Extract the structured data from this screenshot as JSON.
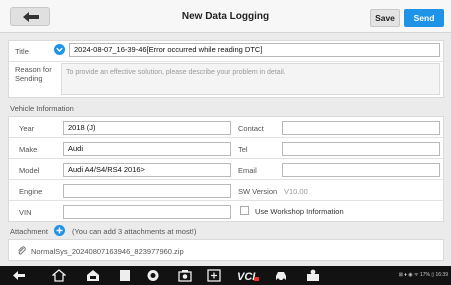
{
  "header": {
    "title": "New Data Logging",
    "save_label": "Save",
    "send_label": "Send"
  },
  "form": {
    "title_label": "Title",
    "title_value": "2024-08-07_16-39-46[Error occurred while reading DTC]",
    "reason_label": "Reason for Sending",
    "reason_placeholder": "To provide an effective solution, please describe your problem in detail."
  },
  "vehicle": {
    "section_label": "Vehicle Information",
    "year_label": "Year",
    "year_value": "2018 (J)",
    "make_label": "Make",
    "make_value": "Audi",
    "model_label": "Model",
    "model_value": "Audi A4/S4/RS4 2016>",
    "engine_label": "Engine",
    "engine_value": "",
    "vin_label": "VIN",
    "vin_value": "",
    "contact_label": "Contact",
    "contact_value": "",
    "tel_label": "Tel",
    "tel_value": "",
    "email_label": "Email",
    "email_value": "",
    "sw_version_label": "SW Version",
    "sw_version_value": "V10.00",
    "workshop_label": "Use Workshop Information"
  },
  "attachment": {
    "label": "Attachment",
    "hint": "(You can add 3 attachments at most!)",
    "file_name": "NormalSys_20240807163946_823977960.zip"
  },
  "status_bar": {
    "text": "⊠ ♦ ◉ ᯤ 17% ▯ 16:39"
  },
  "nav_icons": [
    "back-icon",
    "home-icon",
    "vehicle-home-icon",
    "recent-apps-icon",
    "browser-icon",
    "camera-icon",
    "screenshot-icon",
    "vci-icon",
    "car-icon",
    "service-icon"
  ],
  "colors": {
    "accent": "#1f93e6",
    "background": "#ebebeb",
    "navbar": "#121212"
  }
}
